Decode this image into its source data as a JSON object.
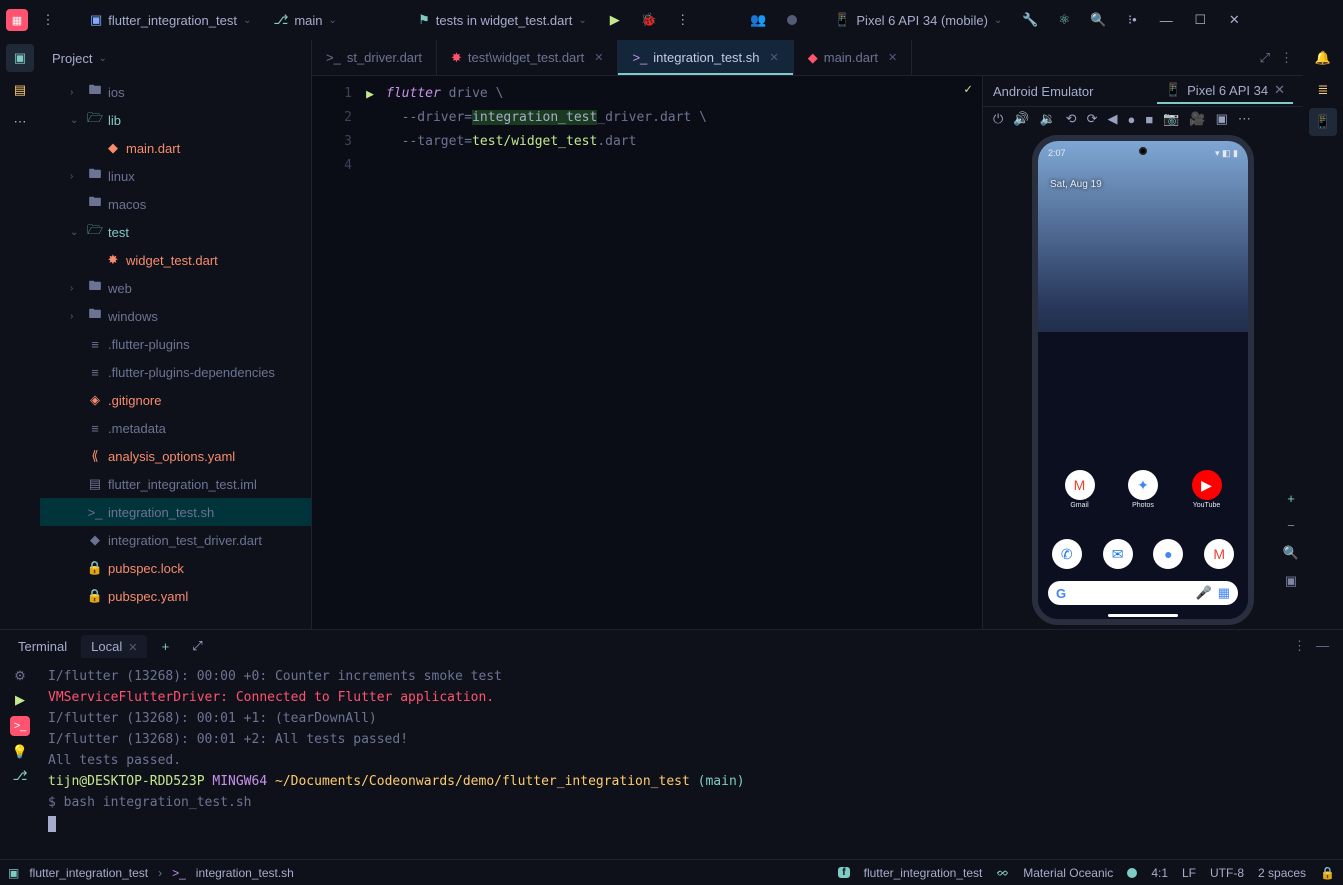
{
  "toolbar": {
    "project_name": "flutter_integration_test",
    "branch": "main",
    "run_config": "tests in widget_test.dart",
    "device": "Pixel 6 API 34 (mobile)"
  },
  "project_panel": {
    "title": "Project",
    "tree": [
      {
        "depth": 1,
        "arrow": ">",
        "icon": "folder-icon",
        "label": "ios",
        "cls": "gray"
      },
      {
        "depth": 1,
        "arrow": "v",
        "icon": "folder-open-icon",
        "label": "lib",
        "cls": "teal"
      },
      {
        "depth": 2,
        "arrow": "",
        "icon": "dart-icon",
        "label": "main.dart",
        "cls": "orange"
      },
      {
        "depth": 1,
        "arrow": ">",
        "icon": "folder-icon",
        "label": "linux",
        "cls": "gray"
      },
      {
        "depth": 1,
        "arrow": "",
        "icon": "folder-icon",
        "label": "macos",
        "cls": "gray"
      },
      {
        "depth": 1,
        "arrow": "v",
        "icon": "folder-open-icon",
        "label": "test",
        "cls": "teal"
      },
      {
        "depth": 2,
        "arrow": "",
        "icon": "dart-test-icon",
        "label": "widget_test.dart",
        "cls": "orange"
      },
      {
        "depth": 1,
        "arrow": ">",
        "icon": "folder-icon",
        "label": "web",
        "cls": "gray"
      },
      {
        "depth": 1,
        "arrow": ">",
        "icon": "folder-icon",
        "label": "windows",
        "cls": "gray"
      },
      {
        "depth": 1,
        "arrow": "",
        "icon": "file-icon",
        "label": ".flutter-plugins",
        "cls": "gray"
      },
      {
        "depth": 1,
        "arrow": "",
        "icon": "file-icon",
        "label": ".flutter-plugins-dependencies",
        "cls": "gray"
      },
      {
        "depth": 1,
        "arrow": "",
        "icon": "git-icon",
        "label": ".gitignore",
        "cls": "orange"
      },
      {
        "depth": 1,
        "arrow": "",
        "icon": "file-icon",
        "label": ".metadata",
        "cls": "gray"
      },
      {
        "depth": 1,
        "arrow": "",
        "icon": "yaml-icon",
        "label": "analysis_options.yaml",
        "cls": "orange"
      },
      {
        "depth": 1,
        "arrow": "",
        "icon": "iml-icon",
        "label": "flutter_integration_test.iml",
        "cls": "gray"
      },
      {
        "depth": 1,
        "arrow": "",
        "icon": "sh-icon",
        "label": "integration_test.sh",
        "cls": "gray",
        "sel": true
      },
      {
        "depth": 1,
        "arrow": "",
        "icon": "dart-icon",
        "label": "integration_test_driver.dart",
        "cls": "gray"
      },
      {
        "depth": 1,
        "arrow": "",
        "icon": "lock-icon",
        "label": "pubspec.lock",
        "cls": "orange"
      },
      {
        "depth": 1,
        "arrow": "",
        "icon": "lock-icon",
        "label": "pubspec.yaml",
        "cls": "orange"
      }
    ]
  },
  "tabs": [
    {
      "icon": "sh-icon",
      "label": "st_driver.dart",
      "active": false,
      "close": false,
      "cls": "gray",
      "partial": true
    },
    {
      "icon": "dart-test-icon",
      "label": "test\\widget_test.dart",
      "active": false,
      "close": true,
      "cls": "red"
    },
    {
      "icon": "sh-icon",
      "label": "integration_test.sh",
      "active": true,
      "close": true,
      "cls": "purple"
    },
    {
      "icon": "dart-icon",
      "label": "main.dart",
      "active": false,
      "close": true,
      "cls": "red"
    }
  ],
  "code_lines": [
    {
      "n": "1",
      "run": true,
      "html": "<span class='purple' style='font-style:italic'>flutter</span><span class='gray'> drive \\</span>"
    },
    {
      "n": "2",
      "run": false,
      "html": "<span class='gray'>  --driver=</span><span class='match-hl'>integration_test</span><span class='gray'>_driver.dart \\</span>"
    },
    {
      "n": "3",
      "run": false,
      "html": "<span class='gray'>  --target=</span><span class='green'>test/widget_test</span><span class='gray'>.dart</span>"
    },
    {
      "n": "4",
      "run": false,
      "html": ""
    }
  ],
  "emulator": {
    "title": "Android Emulator",
    "tab": "Pixel 6 API 34",
    "status_time": "2:07",
    "date": "Sat, Aug 19",
    "row1": [
      {
        "emoji": "M",
        "bg": "#fff",
        "clr": "#ea4335",
        "label": "Gmail"
      },
      {
        "emoji": "✦",
        "bg": "#fff",
        "clr": "#4285f4",
        "label": "Photos"
      },
      {
        "emoji": "▶",
        "bg": "#ff0000",
        "clr": "#fff",
        "label": "YouTube"
      }
    ],
    "dock": [
      {
        "emoji": "✆",
        "bg": "#fff",
        "clr": "#1a73e8"
      },
      {
        "emoji": "✉",
        "bg": "#fff",
        "clr": "#1a73e8"
      },
      {
        "emoji": "●",
        "bg": "#fff",
        "clr": "#4285f4"
      },
      {
        "emoji": "M",
        "bg": "#fff",
        "clr": "#ea4335"
      }
    ]
  },
  "terminal": {
    "title": "Terminal",
    "tab": "Local",
    "lines": [
      {
        "html": "<span class='gray'>I/flutter (13268): 00:00 +0: Counter increments smoke test</span>"
      },
      {
        "html": "<span class='red'>VMServiceFlutterDriver: Connected to Flutter application.</span>"
      },
      {
        "html": "<span class='gray'>I/flutter (13268): 00:01 +1: (tearDownAll)</span>"
      },
      {
        "html": "<span class='gray'>I/flutter (13268): 00:01 +2: All tests passed!</span>"
      },
      {
        "html": "<span class='gray'>All tests passed.</span>"
      },
      {
        "html": ""
      },
      {
        "html": "<span class='green'>tijn@DESKTOP-RDD523P</span> <span class='purple'>MINGW64</span> <span class='yellow'>~/Documents/Codeonwards/demo/flutter_integration_test</span> <span class='teal'>(main)</span>"
      },
      {
        "html": "<span class='gray'>$ bash integration_test.sh</span>"
      }
    ]
  },
  "statusbar": {
    "crumb1": "flutter_integration_test",
    "crumb2": "integration_test.sh",
    "project": "flutter_integration_test",
    "theme": "Material Oceanic",
    "pos": "4:1",
    "lf": "LF",
    "enc": "UTF-8",
    "indent": "2 spaces"
  }
}
